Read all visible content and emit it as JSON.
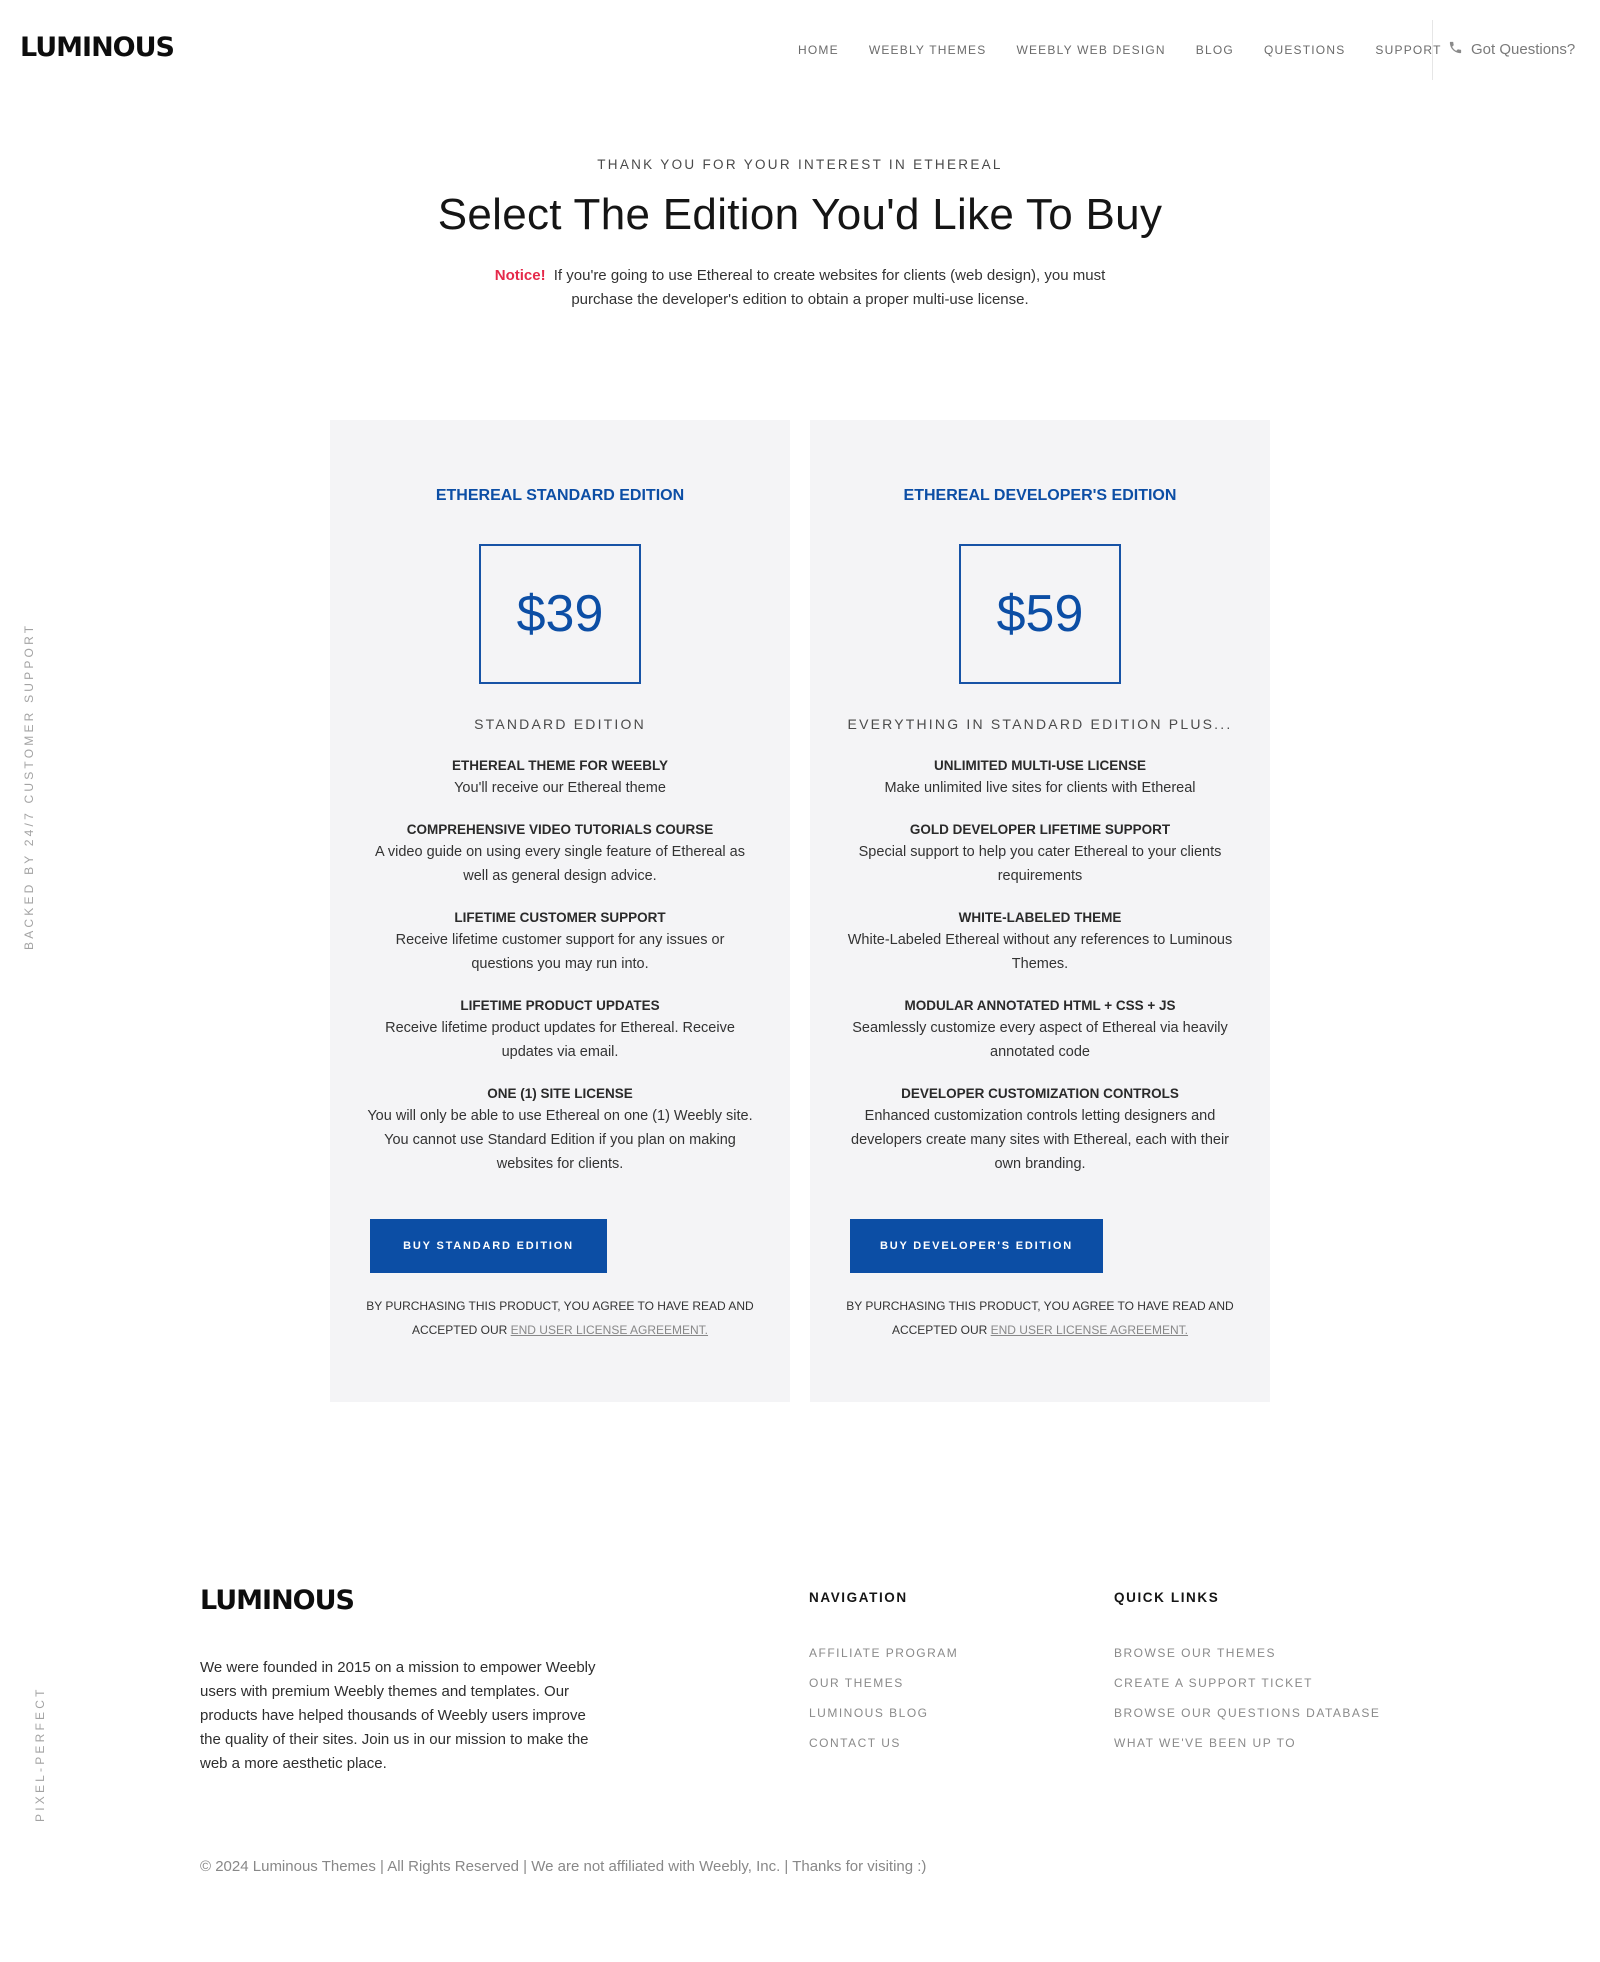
{
  "brand": {
    "logo_text": "LUMINOUS"
  },
  "nav": {
    "items": [
      "HOME",
      "WEEBLY THEMES",
      "WEEBLY WEB DESIGN",
      "BLOG",
      "QUESTIONS",
      "SUPPORT"
    ],
    "phone_label": "Got Questions?"
  },
  "side": {
    "support_text": "BACKED BY 24/7 CUSTOMER SUPPORT",
    "pixel_text": "PIXEL-PERFECT"
  },
  "hero": {
    "eyebrow": "THANK YOU FOR YOUR INTEREST IN ETHEREAL",
    "title": "Select The Edition You'd Like To Buy",
    "notice_label": "Notice!",
    "notice_text": "If you're going to use Ethereal to create websites for clients (web design), you must purchase the developer's edition to obtain a proper multi-use license."
  },
  "cards": [
    {
      "title": "ETHEREAL STANDARD EDITION",
      "price": "$39",
      "subtitle": "STANDARD EDITION",
      "features": [
        {
          "title": "ETHEREAL THEME FOR WEEBLY",
          "desc": "You'll receive our Ethereal theme"
        },
        {
          "title": "COMPREHENSIVE VIDEO TUTORIALS COURSE",
          "desc": "A video guide on using every single feature of Ethereal as well as general design advice."
        },
        {
          "title": "LIFETIME CUSTOMER SUPPORT",
          "desc": "Receive lifetime customer support for any issues or questions you may run into."
        },
        {
          "title": "LIFETIME PRODUCT UPDATES",
          "desc": "Receive lifetime product updates for Ethereal. Receive updates via email."
        },
        {
          "title": "ONE (1) SITE LICENSE",
          "desc": "You will only be able to use Ethereal on one (1) Weebly site. You cannot use Standard Edition if you plan on making websites for clients."
        }
      ],
      "button": "BUY STANDARD EDITION",
      "agree_text": "BY PURCHASING THIS PRODUCT, YOU AGREE TO HAVE READ AND ACCEPTED OUR",
      "agree_link": "END USER LICENSE AGREEMENT."
    },
    {
      "title": "ETHEREAL DEVELOPER'S EDITION",
      "price": "$59",
      "subtitle": "EVERYTHING IN STANDARD EDITION PLUS...",
      "features": [
        {
          "title": "UNLIMITED MULTI-USE LICENSE",
          "desc": "Make unlimited live sites for clients with Ethereal"
        },
        {
          "title": "GOLD DEVELOPER LIFETIME SUPPORT",
          "desc": "Special support to help you cater Ethereal to your clients requirements"
        },
        {
          "title": "WHITE-LABELED THEME",
          "desc": "White-Labeled Ethereal without any references to Luminous Themes."
        },
        {
          "title": "MODULAR ANNOTATED HTML + CSS + JS",
          "desc": "Seamlessly customize every aspect of Ethereal via heavily annotated code"
        },
        {
          "title": "DEVELOPER CUSTOMIZATION CONTROLS",
          "desc": "Enhanced customization controls letting designers and developers create many sites with Ethereal, each with their own branding."
        }
      ],
      "button": "BUY DEVELOPER'S EDITION",
      "agree_text": "BY PURCHASING THIS PRODUCT, YOU AGREE TO HAVE READ AND ACCEPTED OUR",
      "agree_link": "END USER LICENSE AGREEMENT."
    }
  ],
  "footer": {
    "about": "We were founded in 2015 on a mission to empower Weebly users with premium Weebly themes and templates. Our products have helped thousands of Weebly users improve the quality of their sites. Join us in our mission to make the web a more aesthetic place.",
    "nav_heading": "NAVIGATION",
    "nav_links": [
      "AFFILIATE PROGRAM",
      "OUR THEMES",
      "LUMINOUS BLOG",
      "CONTACT US"
    ],
    "quick_heading": "QUICK LINKS",
    "quick_links": [
      "BROWSE OUR THEMES",
      "CREATE A SUPPORT TICKET",
      "BROWSE OUR QUESTIONS DATABASE",
      "WHAT WE'VE BEEN UP TO"
    ],
    "copyright": "© 2024 Luminous Themes | All Rights Reserved | We are not affiliated with Weebly, Inc. | Thanks for visiting :)"
  },
  "colors": {
    "accent": "#0c4ea5",
    "notice": "#e5294a",
    "card_bg": "#f4f4f6"
  }
}
